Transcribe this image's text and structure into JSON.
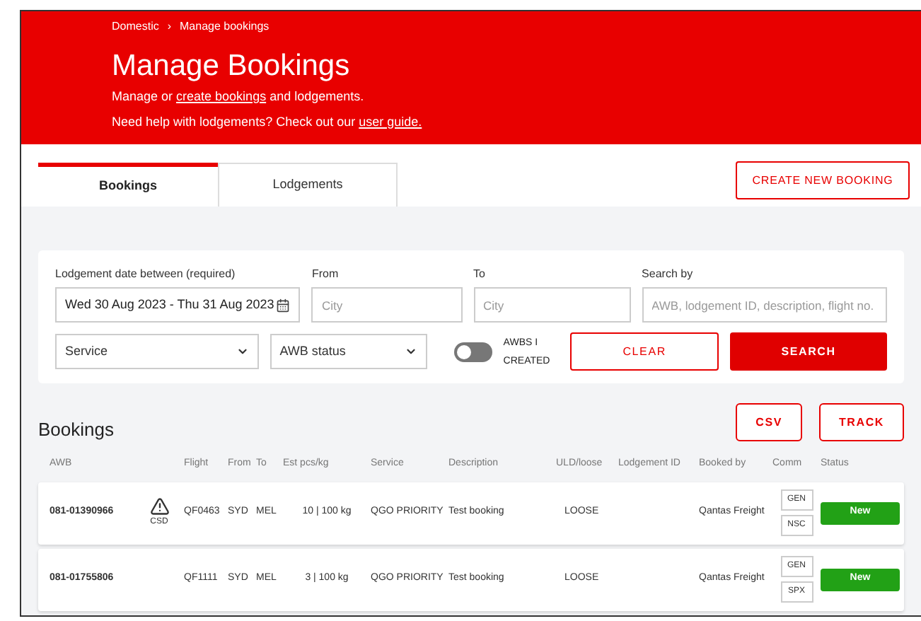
{
  "breadcrumb": {
    "items": [
      "Domestic",
      "Manage bookings"
    ],
    "separator": "›"
  },
  "header": {
    "title": "Manage Bookings",
    "intro": {
      "before": "Manage or ",
      "link": "create bookings",
      "after": " and lodgements."
    },
    "help": {
      "before": "Need help with lodgements? Check out our ",
      "link": "user guide."
    }
  },
  "tabs": [
    {
      "label": "Bookings",
      "selected": true
    },
    {
      "label": "Lodgements",
      "selected": false
    }
  ],
  "create_button": "CREATE NEW BOOKING",
  "filters": {
    "date": {
      "label": "Lodgement date between (required)",
      "value": "Wed 30 Aug 2023 - Thu 31 Aug 2023"
    },
    "from": {
      "label": "From",
      "placeholder": "City"
    },
    "to": {
      "label": "To",
      "placeholder": "City"
    },
    "search_by": {
      "label": "Search by",
      "placeholder": "AWB, lodgement ID, description, flight no."
    },
    "service": {
      "value": "Service"
    },
    "awb_status": {
      "value": "AWB status"
    },
    "toggle": {
      "label": "AWBS I CREATED",
      "on": false
    },
    "clear_button": "CLEAR",
    "search_button": "SEARCH"
  },
  "bookings": {
    "title": "Bookings",
    "buttons": [
      "CSV",
      "TRACK"
    ],
    "columns": [
      "AWB",
      "",
      "Flight",
      "From",
      "To",
      "Est pcs/kg",
      "Service",
      "Description",
      "ULD/loose",
      "Lodgement ID",
      "Booked by",
      "Comm",
      "Status"
    ],
    "rows": [
      {
        "awb": "081-01390966",
        "flag": "CSD",
        "flight": "QF0463",
        "from": "SYD",
        "to": "MEL",
        "est": "10 | 100 kg",
        "service": "QGO PRIORITY",
        "description": "Test booking",
        "uld": "LOOSE",
        "booked_by": "Qantas Freight",
        "comm": [
          "GEN",
          "NSC"
        ],
        "status": "New"
      },
      {
        "awb": "081-01755806",
        "flight": "QF1111",
        "from": "SYD",
        "to": "MEL",
        "est": "3 | 100 kg",
        "service": "QGO PRIORITY",
        "description": "Test booking",
        "uld": "LOOSE",
        "booked_by": "Qantas Freight",
        "comm": [
          "GEN",
          "SPX"
        ],
        "status": "New"
      }
    ]
  }
}
